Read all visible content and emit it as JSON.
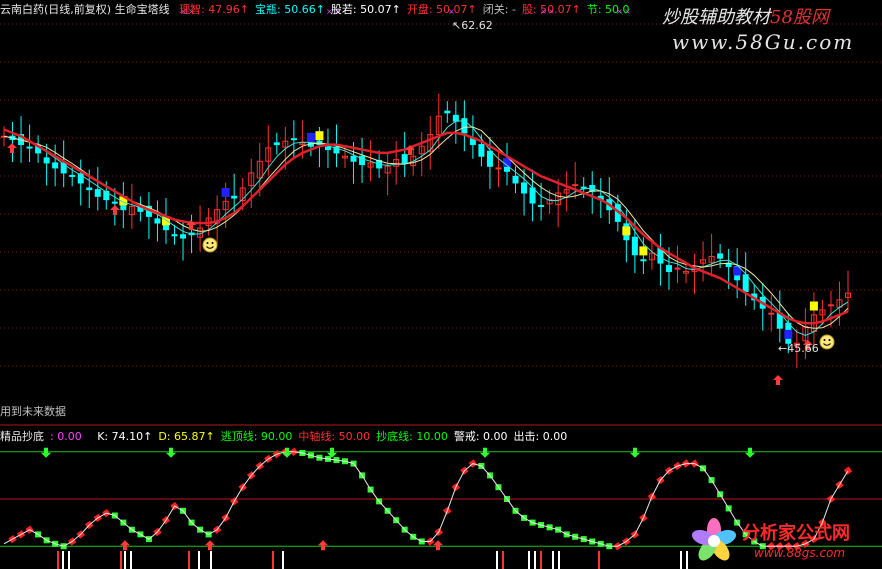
{
  "header": {
    "title": "云南白药(日线,前复权) 生命宝塔线",
    "items": [
      {
        "label": "理智:",
        "value": "47.96",
        "arrow": "↑",
        "color": "#ff3030"
      },
      {
        "label": "宝瓶:",
        "value": "50.66",
        "arrow": "↑",
        "color": "#00ffff"
      },
      {
        "label": "股若:",
        "value": "50.07",
        "arrow": "↑",
        "color": "#ffffff"
      },
      {
        "label": "开盘:",
        "value": "50.07",
        "arrow": "↑",
        "color": "#ff3030"
      },
      {
        "label": "闭关:",
        "value": "-",
        "arrow": "",
        "color": "#c0c0c0"
      },
      {
        "label": "股:",
        "value": "50.07",
        "arrow": "↑",
        "color": "#ff3030"
      },
      {
        "label": "节:",
        "value": "50.0",
        "arrow": "",
        "color": "#00ff00"
      }
    ]
  },
  "watermarks": {
    "top_line": "炒股辅助教材",
    "top_brand": "58股网",
    "top_url": "www.58Gu.com",
    "bottom_brand": "分析家公式网",
    "bottom_url": "www.88gs.com"
  },
  "annotations": {
    "high_label": "62.62",
    "low_label": "←45.66",
    "future_label": "用到未来数据"
  },
  "indicator_header": {
    "title": "精品抄底",
    "title_value": ": 0.00",
    "items": [
      {
        "label": "K:",
        "value": "74.10",
        "arrow": "↑",
        "color": "#ffffff"
      },
      {
        "label": "D:",
        "value": "65.87",
        "arrow": "↑",
        "color": "#ffff00"
      },
      {
        "label": "逃顶线:",
        "value": "90.00",
        "arrow": "",
        "color": "#00ff00"
      },
      {
        "label": "中轴线:",
        "value": "50.00",
        "arrow": "",
        "color": "#ff3030"
      },
      {
        "label": "抄底线:",
        "value": "10.00",
        "arrow": "",
        "color": "#00ff00"
      },
      {
        "label": "警戒:",
        "value": "0.00",
        "arrow": "",
        "color": "#ffffff"
      },
      {
        "label": "出击:",
        "value": "0.00",
        "arrow": "",
        "color": "#ffffff"
      }
    ]
  },
  "colors": {
    "up": "#ff3030",
    "down": "#00ffff",
    "ma_long": "#e0202a",
    "osc_up": "#ff2020",
    "osc_down": "#30ff30",
    "grid": "#8a1010"
  },
  "chart_data": [
    {
      "type": "line",
      "panel": "price",
      "xlabel": "",
      "ylabel": "",
      "ylim": [
        43,
        66
      ],
      "x_count": 100,
      "series": [
        {
          "name": "close",
          "values": [
            58.8,
            58.6,
            58.3,
            58.1,
            57.8,
            57.2,
            56.9,
            56.6,
            56.4,
            56.0,
            55.6,
            55.2,
            55.0,
            54.8,
            54.4,
            54.6,
            54.3,
            54.0,
            53.6,
            53.2,
            52.9,
            52.7,
            52.9,
            53.3,
            53.9,
            54.4,
            54.9,
            55.1,
            55.7,
            56.6,
            57.3,
            58.1,
            58.3,
            58.5,
            58.6,
            58.4,
            58.2,
            58.3,
            58.0,
            57.8,
            57.6,
            57.3,
            57.1,
            57.2,
            56.9,
            57.0,
            57.4,
            57.2,
            57.6,
            58.2,
            58.9,
            60.0,
            60.2,
            59.7,
            59.0,
            58.3,
            57.6,
            57.0,
            56.9,
            56.7,
            56.0,
            55.4,
            54.8,
            54.6,
            55.0,
            55.4,
            55.6,
            55.9,
            55.7,
            55.5,
            55.0,
            54.4,
            53.7,
            52.6,
            51.7,
            51.4,
            51.8,
            51.2,
            50.7,
            50.9,
            50.7,
            50.9,
            51.4,
            51.6,
            51.5,
            51.0,
            50.2,
            49.5,
            49.0,
            48.5,
            48.2,
            47.3,
            46.4,
            46.4,
            47.4,
            48.1,
            48.4,
            48.7,
            49.0,
            49.4
          ]
        },
        {
          "name": "MA",
          "values": [
            59.2,
            59.0,
            58.8,
            58.5,
            58.2,
            57.9,
            57.6,
            57.3,
            57.0,
            56.7,
            56.4,
            56.1,
            55.8,
            55.5,
            55.2,
            54.9,
            54.6,
            54.4,
            54.2,
            54.0,
            53.8,
            53.7,
            53.6,
            53.6,
            53.6,
            53.7,
            53.9,
            54.2,
            54.6,
            55.1,
            55.6,
            56.1,
            56.6,
            57.1,
            57.5,
            57.8,
            58.0,
            58.2,
            58.3,
            58.3,
            58.2,
            58.1,
            58.0,
            57.9,
            57.8,
            57.8,
            57.9,
            58.0,
            58.2,
            58.4,
            58.6,
            58.8,
            59.0,
            59.0,
            58.9,
            58.7,
            58.5,
            58.2,
            57.9,
            57.6,
            57.3,
            57.0,
            56.7,
            56.4,
            56.2,
            56.0,
            55.8,
            55.6,
            55.4,
            55.2,
            55.0,
            54.7,
            54.3,
            53.9,
            53.4,
            52.9,
            52.5,
            52.1,
            51.8,
            51.5,
            51.2,
            50.9,
            50.7,
            50.5,
            50.3,
            50.0,
            49.7,
            49.4,
            49.1,
            48.8,
            48.5,
            48.2,
            47.9,
            47.7,
            47.6,
            47.6,
            47.7,
            47.9,
            48.1,
            48.3
          ]
        }
      ]
    },
    {
      "type": "line",
      "panel": "indicator",
      "xlabel": "",
      "ylabel": "",
      "ylim": [
        0,
        100
      ],
      "levels": [
        90,
        50,
        10
      ],
      "x_count": 100,
      "series": [
        {
          "name": "K",
          "values": [
            12,
            16,
            20,
            24,
            20,
            15,
            12,
            10,
            14,
            20,
            28,
            34,
            38,
            36,
            30,
            24,
            20,
            16,
            22,
            32,
            44,
            40,
            30,
            24,
            20,
            24,
            34,
            48,
            60,
            70,
            78,
            84,
            88,
            90,
            90,
            89,
            87,
            85,
            84,
            83,
            82,
            80,
            70,
            58,
            48,
            40,
            32,
            24,
            18,
            14,
            14,
            22,
            40,
            60,
            74,
            80,
            78,
            70,
            60,
            50,
            40,
            34,
            30,
            28,
            26,
            24,
            20,
            18,
            16,
            14,
            12,
            10,
            10,
            14,
            20,
            34,
            52,
            66,
            74,
            78,
            80,
            80,
            76,
            66,
            54,
            42,
            30,
            20,
            14,
            10,
            10,
            10,
            10,
            10,
            12,
            16,
            30,
            50,
            62,
            74
          ]
        }
      ]
    }
  ]
}
